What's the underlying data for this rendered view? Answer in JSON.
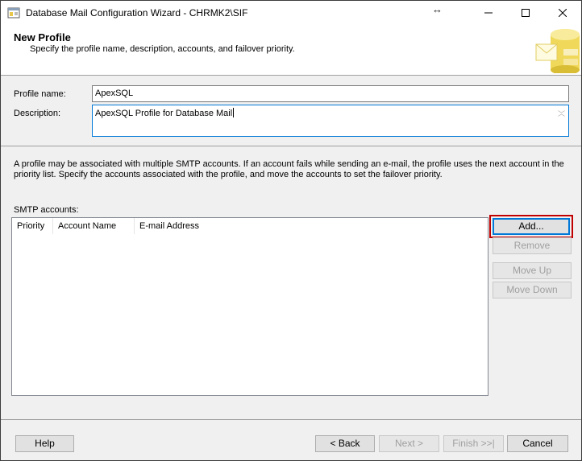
{
  "window": {
    "title": "Database Mail Configuration Wizard - CHRMK2\\SIF",
    "resize_glyph": "↔"
  },
  "header": {
    "title": "New Profile",
    "subtitle": "Specify the profile name, description, accounts, and failover priority."
  },
  "form": {
    "profile_name_label": "Profile name:",
    "profile_name_value": "ApexSQL",
    "description_label": "Description:",
    "description_value": "ApexSQL Profile for Database Mail"
  },
  "info_text": "A profile may be associated with multiple SMTP accounts. If an account fails while sending an e-mail, the profile uses the next account in the priority list. Specify the accounts associated with the profile, and move the accounts to set the failover priority.",
  "smtp": {
    "label": "SMTP accounts:",
    "columns": [
      "Priority",
      "Account Name",
      "E-mail Address"
    ],
    "rows": []
  },
  "side_buttons": {
    "add": "Add...",
    "remove": "Remove",
    "move_up": "Move Up",
    "move_down": "Move Down"
  },
  "footer": {
    "help": "Help",
    "back": "< Back",
    "next": "Next >",
    "finish": "Finish >>|",
    "cancel": "Cancel"
  },
  "colors": {
    "highlight": "#c00000",
    "focus_blue": "#0078d7",
    "dialog_bg": "#f0f0f0"
  }
}
